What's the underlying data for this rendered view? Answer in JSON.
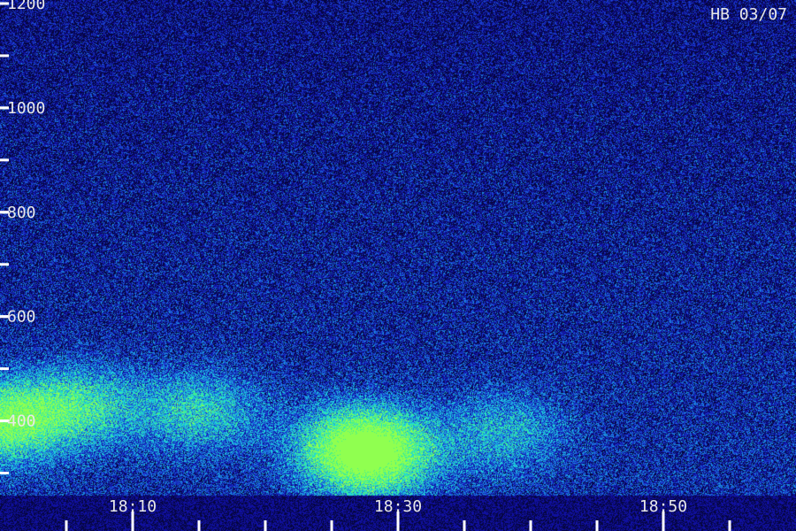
{
  "chart_data": {
    "type": "heatmap",
    "title": "HB 03/07",
    "xlabel": "",
    "ylabel": "",
    "x_tick_labels": [
      "18:10",
      "18:30",
      "18:50"
    ],
    "y_tick_labels": [
      "1200",
      "1000",
      "800",
      "600",
      "400"
    ],
    "y_ticks": [
      400,
      600,
      800,
      1000,
      1200
    ],
    "ylim": [
      250,
      1200
    ],
    "x_ticks_minutes": [
      10,
      30,
      50
    ],
    "xlim_minutes": [
      0,
      60
    ],
    "x_minor_tick_step_minutes": 5,
    "y_minor_tick_step": 100,
    "colormap": [
      "#06063f",
      "#1010a0",
      "#1a3fd0",
      "#1a90e0",
      "#20d8d8",
      "#40f090",
      "#90ff50"
    ],
    "intensity_peaks": [
      {
        "x_minutes": 0,
        "y": 400,
        "level": 0.85
      },
      {
        "x_minutes": 6,
        "y": 430,
        "level": 0.55
      },
      {
        "x_minutes": 15,
        "y": 420,
        "level": 0.5
      },
      {
        "x_minutes": 27,
        "y": 360,
        "level": 0.6
      },
      {
        "x_minutes": 28,
        "y": 330,
        "level": 0.75
      },
      {
        "x_minutes": 38,
        "y": 380,
        "level": 0.4
      }
    ]
  }
}
